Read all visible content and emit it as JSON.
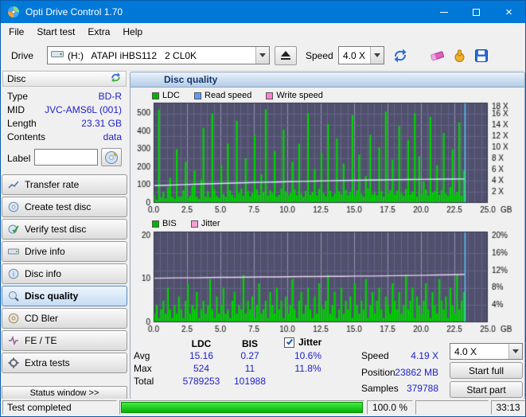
{
  "window": {
    "title": "Opti Drive Control 1.70",
    "close_glyph": "×"
  },
  "menubar": {
    "items": [
      "File",
      "Start test",
      "Extra",
      "Help"
    ]
  },
  "toolbar": {
    "drive_label": "Drive",
    "drive_value": "(H:)   ATAPI iHBS112   2 CL0K",
    "speed_label": "Speed",
    "speed_value": "4.0 X"
  },
  "sidebar": {
    "disc_header": "Disc",
    "info": [
      {
        "label": "Type",
        "value": "BD-R"
      },
      {
        "label": "MID",
        "value": "JVC-AMS6L (001)"
      },
      {
        "label": "Length",
        "value": "23.31 GB"
      },
      {
        "label": "Contents",
        "value": "data"
      }
    ],
    "label_field": {
      "label": "Label",
      "value": ""
    },
    "buttons": [
      "Transfer rate",
      "Create test disc",
      "Verify test disc",
      "Drive info",
      "Disc info",
      "Disc quality",
      "CD Bler",
      "FE / TE",
      "Extra tests"
    ],
    "active_button": "Disc quality",
    "status_window": "Status window >>"
  },
  "panel": {
    "title": "Disc quality"
  },
  "chart_style": {
    "plot_bg": "#50506d",
    "grid": "#65658c",
    "grid_major": "#9090b4",
    "bar": "#00d400",
    "end_marker": "#58c8ff",
    "border": "#30304a"
  },
  "chart_data": [
    {
      "type": "bar",
      "name": "ldc-read-speed-chart",
      "legend": [
        {
          "label": "LDC",
          "color": "#00b400"
        },
        {
          "label": "Read speed",
          "color": "#5f9bff"
        },
        {
          "label": "Write speed",
          "color": "#ff7ed4"
        }
      ],
      "xlim": [
        0,
        25
      ],
      "x_ticks": [
        "0.0",
        "2.5",
        "5.0",
        "7.5",
        "10.0",
        "12.5",
        "15.0",
        "17.5",
        "20.0",
        "22.5",
        "25.0"
      ],
      "x_unit": "GB",
      "ylim": [
        0,
        560
      ],
      "y_ticks_left": [
        0,
        100,
        200,
        300,
        400,
        500
      ],
      "y_ticks_right": [
        {
          "label": "2 X",
          "value": 62
        },
        {
          "label": "4 X",
          "value": 124
        },
        {
          "label": "6 X",
          "value": 187
        },
        {
          "label": "8 X",
          "value": 249
        },
        {
          "label": "10 X",
          "value": 311
        },
        {
          "label": "12 X",
          "value": 373
        },
        {
          "label": "14 X",
          "value": 436
        },
        {
          "label": "16 X",
          "value": 498
        },
        {
          "label": "18 X",
          "value": 560
        }
      ],
      "data_end_gb": 23.3,
      "bars": [
        45,
        18,
        520,
        32,
        60,
        25,
        88,
        140,
        35,
        22,
        300,
        35,
        35,
        70,
        230,
        28,
        40,
        95,
        180,
        35,
        22,
        130,
        420,
        35,
        65,
        30,
        500,
        75,
        40,
        28,
        210,
        50,
        35,
        330,
        70,
        45,
        30,
        460,
        55,
        80,
        40,
        250,
        65,
        35,
        55,
        380,
        75,
        45,
        160,
        60,
        524,
        40,
        70,
        55,
        290,
        35,
        45,
        80,
        410,
        65,
        38,
        55,
        230,
        75,
        42,
        330,
        52,
        35,
        68,
        500,
        45,
        60,
        190,
        42,
        78,
        280,
        55,
        38,
        440,
        68,
        35,
        52,
        360,
        65,
        48,
        220,
        72,
        42,
        60,
        490,
        38,
        70,
        270,
        52,
        35,
        150,
        80,
        380,
        48,
        58,
        42,
        310,
        65,
        35,
        510,
        52,
        72,
        240,
        44,
        68,
        430,
        56,
        40,
        78,
        350,
        48,
        64,
        500,
        36,
        260,
        50,
        120,
        75,
        40,
        480,
        58,
        66,
        210,
        45,
        70,
        390,
        52,
        38,
        88,
        300,
        46,
        62,
        450,
        40,
        180
      ],
      "line": {
        "name": "read-speed",
        "color": "#d8e6ff",
        "unit_scale": 31.1,
        "values": [
          3.1,
          3.19,
          3.27,
          3.35,
          3.43,
          3.5,
          3.57,
          3.64,
          3.7,
          3.76,
          3.82,
          3.88,
          3.93,
          3.98,
          4.03,
          4.07,
          4.11,
          4.15,
          4.18,
          4.21,
          4.24,
          4.26,
          4.28,
          4.3
        ]
      }
    },
    {
      "type": "bar",
      "name": "bis-jitter-chart",
      "legend": [
        {
          "label": "BIS",
          "color": "#00b400"
        },
        {
          "label": "Jitter",
          "color": "#ff9ed4"
        }
      ],
      "xlim": [
        0,
        25
      ],
      "x_ticks": [
        "0.0",
        "2.5",
        "5.0",
        "7.5",
        "10.0",
        "12.5",
        "15.0",
        "17.5",
        "20.0",
        "22.5",
        "25.0"
      ],
      "x_unit": "GB",
      "ylim": [
        0,
        21
      ],
      "y_ticks_left": [
        0,
        10,
        20
      ],
      "y_ticks_right": [
        {
          "label": "4%",
          "value": 4
        },
        {
          "label": "8%",
          "value": 8
        },
        {
          "label": "12%",
          "value": 12
        },
        {
          "label": "16%",
          "value": 16
        },
        {
          "label": "20%",
          "value": 20
        }
      ],
      "data_end_gb": 23.3,
      "bars": [
        2,
        4,
        1,
        3,
        5,
        2,
        8,
        3,
        1,
        4,
        2,
        6,
        3,
        1,
        5,
        9,
        2,
        4,
        3,
        7,
        1,
        3,
        5,
        2,
        4,
        10,
        3,
        1,
        6,
        2,
        4,
        8,
        2,
        3,
        1,
        5,
        7,
        2,
        4,
        3,
        11,
        2,
        5,
        3,
        6,
        1,
        4,
        9,
        2,
        3,
        5,
        1,
        7,
        4,
        2,
        8,
        3,
        5,
        1,
        6,
        2,
        4,
        10,
        3,
        1,
        5,
        7,
        2,
        4,
        8,
        3,
        1,
        6,
        2,
        9,
        4,
        3,
        5,
        11,
        2,
        4,
        7,
        1,
        3,
        8,
        2,
        5,
        3,
        6,
        1,
        9,
        4,
        2,
        5,
        3,
        10,
        1,
        4,
        7,
        2,
        5,
        8,
        3,
        1,
        6,
        4,
        2,
        9,
        5,
        3,
        7,
        2,
        4,
        11,
        3,
        5,
        8,
        1,
        6,
        4,
        2,
        5,
        9,
        3,
        1,
        7,
        4,
        2,
        10,
        5,
        3,
        6,
        1,
        8,
        4,
        2,
        11,
        3,
        5,
        7
      ],
      "line": {
        "name": "jitter",
        "color": "#eed6ee",
        "unit_scale": 1,
        "values": [
          10.2,
          10.25,
          10.3,
          10.3,
          10.35,
          10.4,
          10.4,
          10.45,
          10.5,
          10.5,
          10.55,
          10.6,
          10.6,
          10.65,
          10.65,
          10.7,
          10.7,
          10.75,
          10.8,
          10.85,
          10.9,
          10.95,
          11.0,
          11.1
        ]
      }
    }
  ],
  "stats": {
    "col_ldc": "LDC",
    "col_bis": "BIS",
    "col_jitter": "Jitter",
    "jitter_checked": true,
    "rows": [
      {
        "label": "Avg",
        "ldc": "15.16",
        "bis": "0.27",
        "jitter": "10.6%"
      },
      {
        "label": "Max",
        "ldc": "524",
        "bis": "11",
        "jitter": "11.8%"
      },
      {
        "label": "Total",
        "ldc": "5789253",
        "bis": "101988",
        "jitter": ""
      }
    ],
    "speed_label": "Speed",
    "speed_value": "4.19 X",
    "speed_select": "4.0 X",
    "position_label": "Position",
    "position_value": "23862 MB",
    "start_full": "Start full",
    "samples_label": "Samples",
    "samples_value": "379788",
    "start_part": "Start part"
  },
  "statusbar": {
    "status": "Test completed",
    "progress_pct": 100,
    "progress_text": "100.0 %",
    "time": "33:13"
  }
}
